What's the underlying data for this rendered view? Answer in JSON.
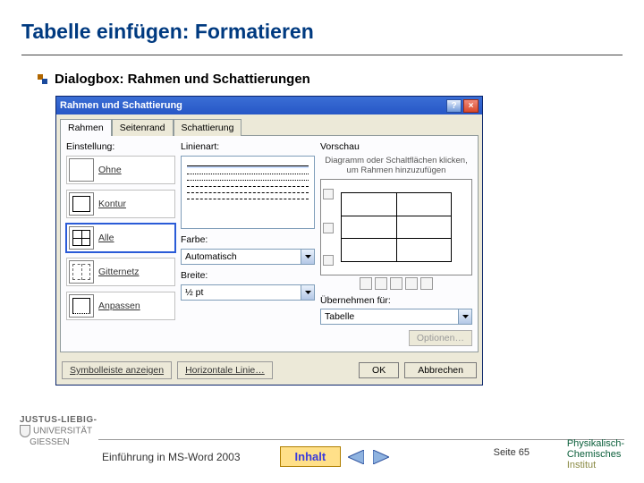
{
  "title": "Tabelle einfügen: Formatieren",
  "bullet": "Dialogbox: Rahmen und Schattierungen",
  "dialog": {
    "titlebar": "Rahmen und Schattierung",
    "help_icon": "?",
    "close_icon": "×",
    "tabs": {
      "t1": "Rahmen",
      "t2": "Seitenrand",
      "t3": "Schattierung"
    },
    "settings_label": "Einstellung:",
    "settings": {
      "none": "Ohne",
      "box": "Kontur",
      "all": "Alle",
      "grid": "Gitternetz",
      "custom": "Anpassen"
    },
    "linestyle_label": "Linienart:",
    "color_label": "Farbe:",
    "color_value": "Automatisch",
    "width_label": "Breite:",
    "width_value": "½ pt",
    "preview_label": "Vorschau",
    "preview_note": "Diagramm oder Schaltflächen klicken, um Rahmen hinzuzufügen",
    "apply_label": "Übernehmen für:",
    "apply_value": "Tabelle",
    "options_btn": "Optionen…",
    "toolbar_btn": "Symbolleiste anzeigen",
    "hline_btn": "Horizontale Linie…",
    "ok_btn": "OK",
    "cancel_btn": "Abbrechen"
  },
  "footer": {
    "brand_top": "JUSTUS-LIEBIG-",
    "brand_mid": "UNIVERSITÄT",
    "brand_bot": "GIESSEN",
    "course": "Einführung in MS-Word 2003",
    "inhalt": "Inhalt",
    "page": "Seite 65",
    "inst1": "Physikalisch-",
    "inst2": "Chemisches",
    "inst3": "Institut"
  }
}
